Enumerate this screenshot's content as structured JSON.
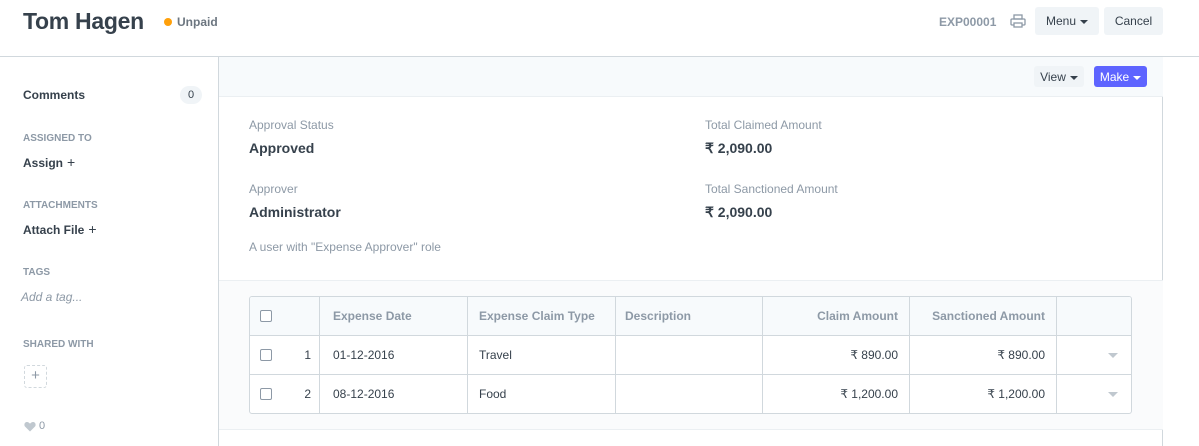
{
  "header": {
    "title": "Tom Hagen",
    "status": "Unpaid",
    "status_color": "#ffa00a",
    "doc_name": "EXP00001",
    "print_icon": "printer-icon",
    "menu_label": "Menu",
    "cancel_label": "Cancel"
  },
  "sidebar": {
    "comments_label": "Comments",
    "comments_count": "0",
    "assigned_label": "ASSIGNED TO",
    "assign_link": "Assign",
    "attachments_label": "ATTACHMENTS",
    "attach_link": "Attach File",
    "tags_label": "TAGS",
    "tag_placeholder": "Add a tag...",
    "shared_label": "SHARED WITH",
    "likes": "0"
  },
  "toolbar": {
    "view_label": "View",
    "make_label": "Make",
    "make_color": "#5e64ff"
  },
  "form": {
    "approval_status_label": "Approval Status",
    "approval_status_value": "Approved",
    "approver_label": "Approver",
    "approver_value": "Administrator",
    "approver_desc": "A user with \"Expense Approver\" role",
    "total_claimed_label": "Total Claimed Amount",
    "total_claimed_value": "₹ 2,090.00",
    "total_sanctioned_label": "Total Sanctioned Amount",
    "total_sanctioned_value": "₹ 2,090.00"
  },
  "table": {
    "columns": [
      "Expense Date",
      "Expense Claim Type",
      "Description",
      "Claim Amount",
      "Sanctioned Amount"
    ],
    "rows": [
      {
        "idx": "1",
        "date": "01-12-2016",
        "type": "Travel",
        "description": "",
        "claim": "₹ 890.00",
        "sanctioned": "₹ 890.00"
      },
      {
        "idx": "2",
        "date": "08-12-2016",
        "type": "Food",
        "description": "",
        "claim": "₹ 1,200.00",
        "sanctioned": "₹ 1,200.00"
      }
    ]
  }
}
